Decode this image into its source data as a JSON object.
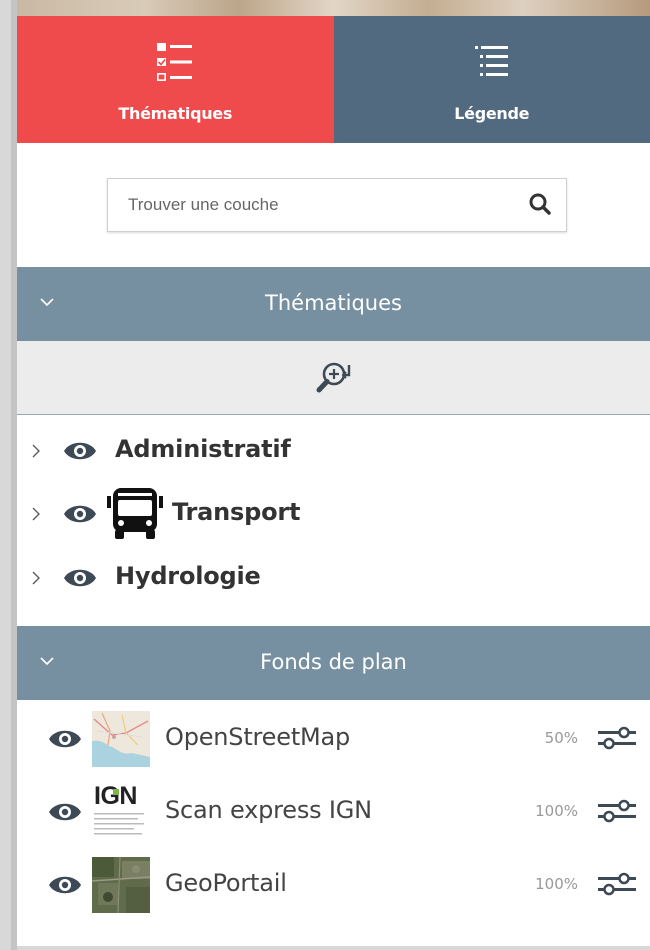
{
  "tabs": [
    {
      "label": "Thématiques",
      "icon": "checklist-icon",
      "active": true
    },
    {
      "label": "Légende",
      "icon": "legend-list-icon",
      "active": false
    }
  ],
  "search": {
    "placeholder": "Trouver une couche",
    "icon": "search-icon"
  },
  "sections": {
    "themes": {
      "title": "Thématiques",
      "icon": "chevron-down-icon"
    },
    "basemaps": {
      "title": "Fonds de plan",
      "icon": "chevron-down-icon"
    }
  },
  "zoom_tool": {
    "icon": "zoom-to-extent-icon"
  },
  "themes": [
    {
      "label": "Administratif",
      "icon": "eye-icon"
    },
    {
      "label": "Transport",
      "icon": "eye-icon",
      "extra_icon": "bus-icon"
    },
    {
      "label": "Hydrologie",
      "icon": "eye-icon"
    }
  ],
  "basemaps": [
    {
      "name": "OpenStreetMap",
      "opacity": "50%",
      "thumb": "osm-thumbnail"
    },
    {
      "name": "Scan express IGN",
      "opacity": "100%",
      "thumb": "ign-thumbnail",
      "thumb_text": "IGN"
    },
    {
      "name": "GeoPortail",
      "opacity": "100%",
      "thumb": "satellite-thumbnail"
    }
  ],
  "colors": {
    "tab_active": "#f04b4c",
    "tab_inactive": "#516a80",
    "section_header": "#7790a1",
    "zoom_bar": "#ececec",
    "icon_dark": "#3d4a55"
  }
}
